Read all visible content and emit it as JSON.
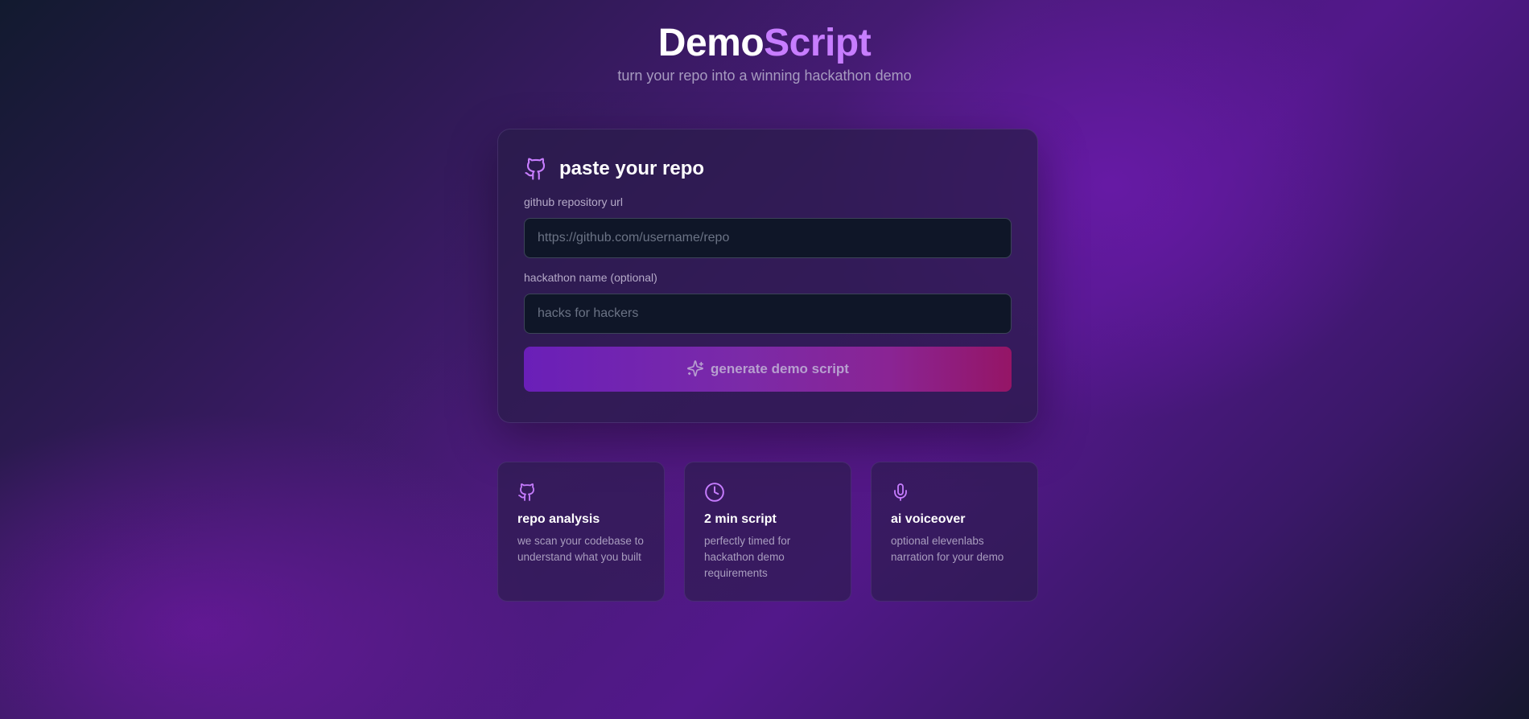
{
  "header": {
    "title_part1": "Demo",
    "title_part2": "Script",
    "subtitle": "turn your repo into a winning hackathon demo"
  },
  "form": {
    "title": "paste your repo",
    "title_icon": "github-icon",
    "repo_label": "github repository url",
    "repo_placeholder": "https://github.com/username/repo",
    "repo_value": "",
    "hackathon_label": "hackathon name (optional)",
    "hackathon_placeholder": "hacks for hackers",
    "hackathon_value": "",
    "submit_label": "generate demo script",
    "submit_icon": "sparkles-icon"
  },
  "features": [
    {
      "icon": "github-icon",
      "title": "repo analysis",
      "description": "we scan your codebase to understand what you built"
    },
    {
      "icon": "clock-icon",
      "title": "2 min script",
      "description": "perfectly timed for hackathon demo requirements"
    },
    {
      "icon": "microphone-icon",
      "title": "ai voiceover",
      "description": "optional elevenlabs narration for your demo"
    }
  ],
  "colors": {
    "accent": "#c77dff",
    "button_start": "#6a1fb8",
    "button_end": "#951566",
    "input_bg": "#0f1628"
  }
}
